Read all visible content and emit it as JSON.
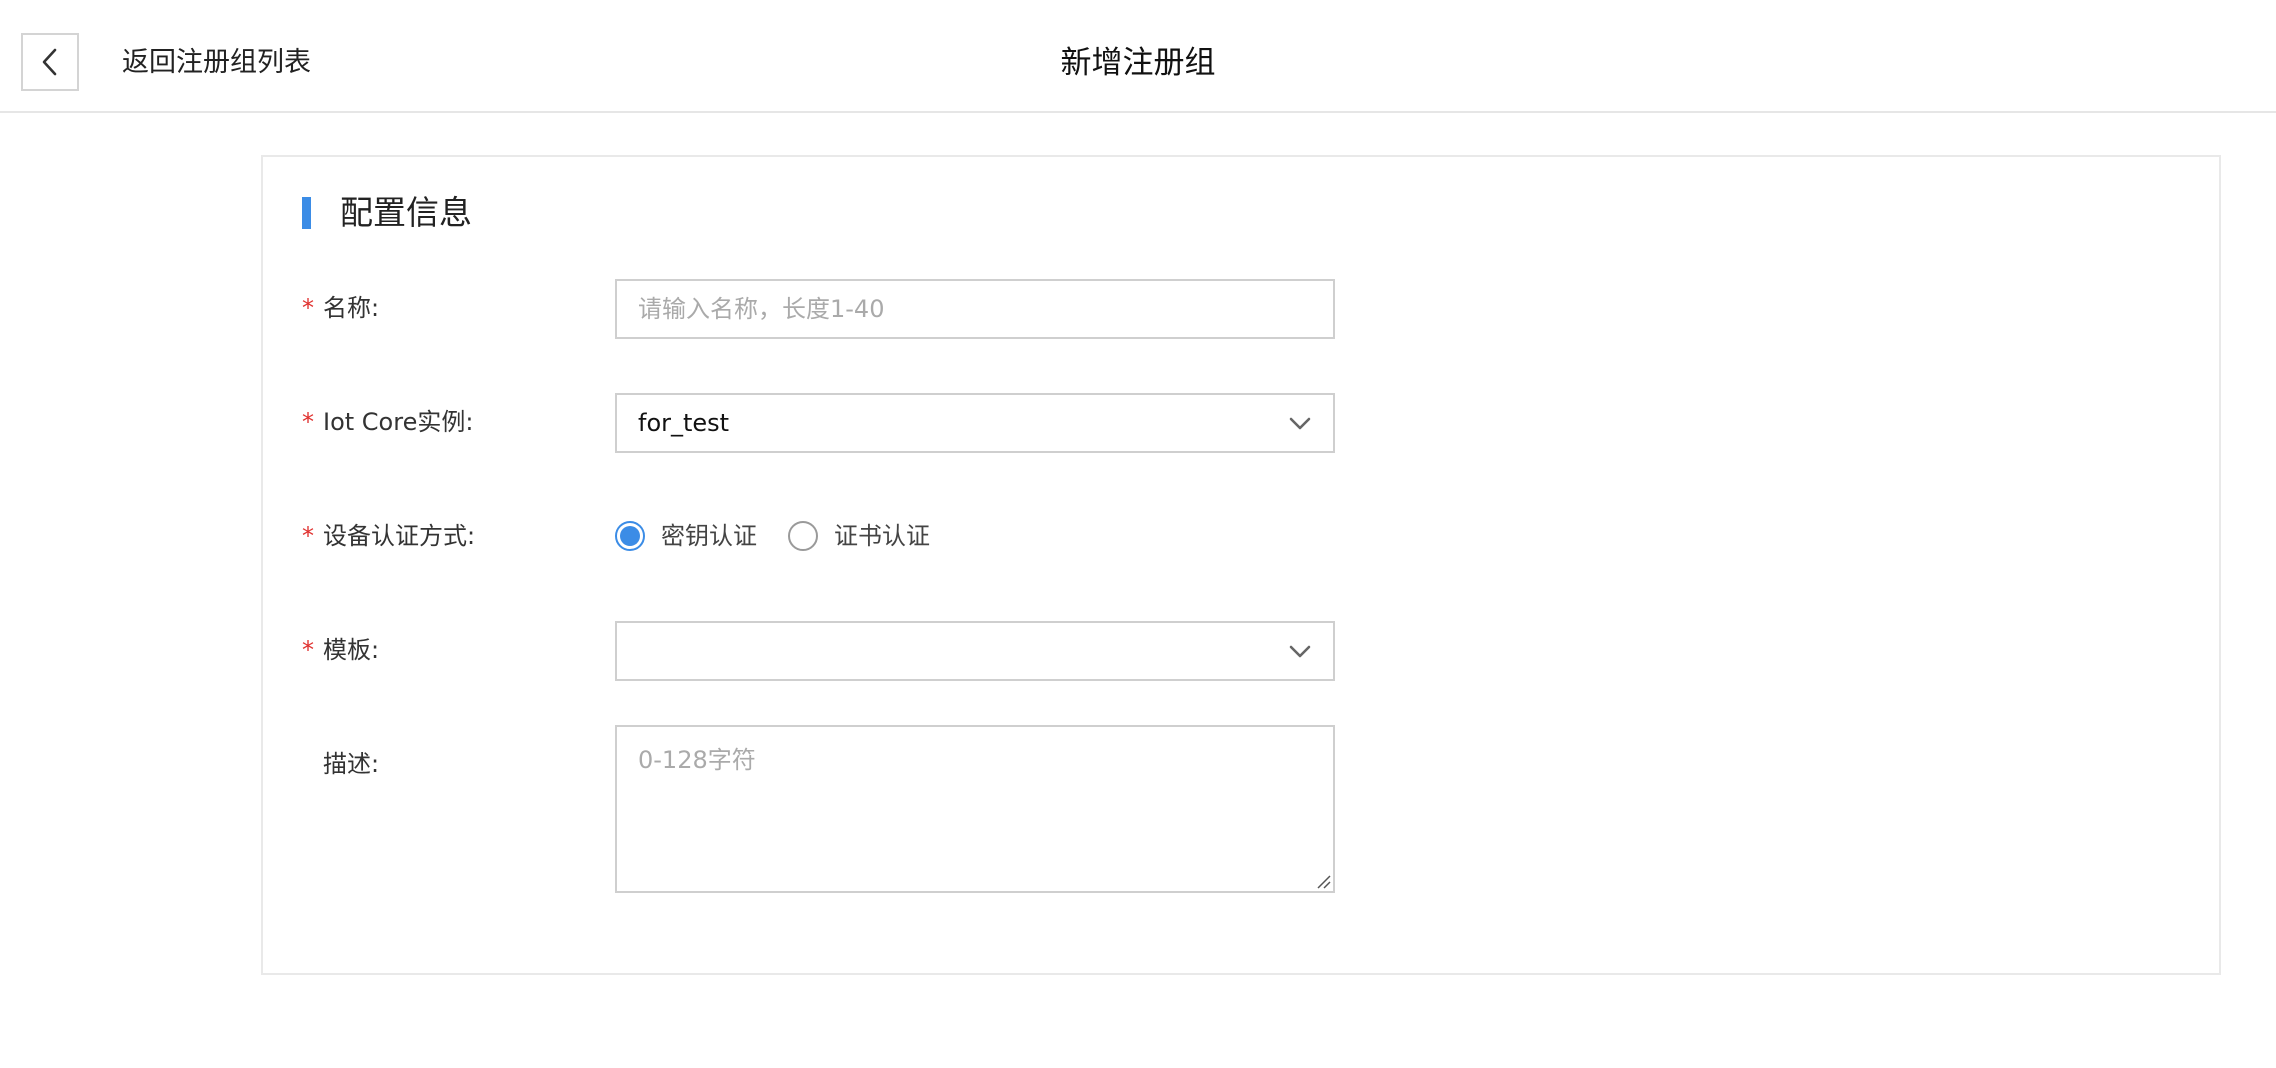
{
  "header": {
    "back_label": "返回注册组列表",
    "title": "新增注册组"
  },
  "section": {
    "title": "配置信息"
  },
  "form": {
    "required_mark": "*",
    "name": {
      "label": "名称:",
      "placeholder": "请输入名称，长度1-40",
      "value": ""
    },
    "instance": {
      "label": "Iot Core实例:",
      "value": "for_test"
    },
    "auth": {
      "label": "设备认证方式:",
      "options": [
        "密钥认证",
        "证书认证"
      ],
      "selected": "密钥认证"
    },
    "template": {
      "label": "模板:",
      "value": ""
    },
    "description": {
      "label": "描述:",
      "placeholder": "0-128字符",
      "value": ""
    }
  },
  "colors": {
    "accent": "#3b8ce6",
    "required": "#e0312f",
    "border": "#cfcfcf"
  },
  "icons": {
    "back": "chevron-left-icon",
    "dropdown": "chevron-down-icon",
    "resize": "resize-grip-icon"
  }
}
